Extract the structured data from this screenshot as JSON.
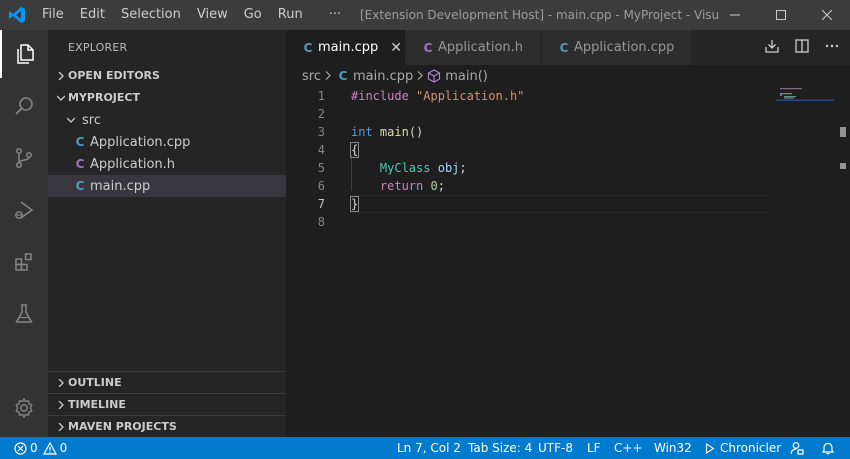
{
  "titlebar": {
    "menu": [
      "File",
      "Edit",
      "Selection",
      "View",
      "Go",
      "Run",
      "···"
    ],
    "window_title": "[Extension Development Host] - main.cpp - MyProject - Visual..."
  },
  "sidebar": {
    "title": "EXPLORER",
    "open_editors": "OPEN EDITORS",
    "project": "MYPROJECT",
    "folder": "src",
    "files": [
      {
        "name": "Application.cpp",
        "kind": "cpp"
      },
      {
        "name": "Application.h",
        "kind": "h"
      },
      {
        "name": "main.cpp",
        "kind": "cpp"
      }
    ],
    "outline": "OUTLINE",
    "timeline": "TIMELINE",
    "maven": "MAVEN PROJECTS"
  },
  "tabs": [
    {
      "label": "main.cpp",
      "kind": "cpp",
      "active": true
    },
    {
      "label": "Application.h",
      "kind": "h",
      "active": false
    },
    {
      "label": "Application.cpp",
      "kind": "cpp",
      "active": false
    }
  ],
  "breadcrumb": {
    "folder": "src",
    "file": "main.cpp",
    "symbol": "main()"
  },
  "code": {
    "line_numbers": [
      "1",
      "2",
      "3",
      "4",
      "5",
      "6",
      "7",
      "8"
    ],
    "include_kw": "#include",
    "include_str": "\"Application.h\"",
    "int_kw": "int",
    "main_fn": "main",
    "parens": "()",
    "open_brace": "{",
    "class_name": "MyClass",
    "obj_var": "obj",
    "semicolon": ";",
    "return_kw": "return",
    "zero": "0",
    "close_brace": "}"
  },
  "statusbar": {
    "errors": "0",
    "warnings": "0",
    "position": "Ln 7, Col 2",
    "tab_size": "Tab Size: 4",
    "encoding": "UTF-8",
    "eol": "LF",
    "language": "C++",
    "platform": "Win32",
    "extension": "Chronicler"
  },
  "colors": {
    "status_bar": "#007acc",
    "activity_bar": "#333333",
    "sidebar": "#252526",
    "editor": "#1e1e1e",
    "cpp_icon": "#519aba",
    "h_icon": "#a074c4"
  }
}
